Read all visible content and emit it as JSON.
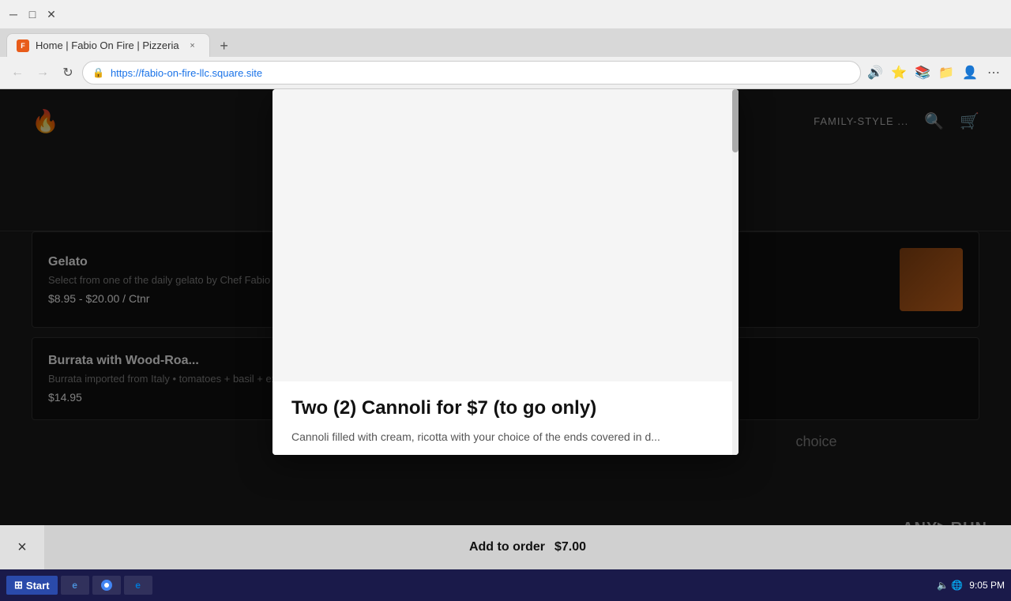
{
  "browser": {
    "title": "Home | Fabio On Fire | Pizzeria",
    "url": "https://fabio-on-fire-llc.square.site",
    "favicon_label": "F",
    "new_tab_label": "+",
    "back_btn": "←",
    "forward_btn": "→",
    "refresh_btn": "↻",
    "tab_close": "×"
  },
  "site": {
    "logo": "🔥",
    "nav_items": [
      "FAMILY-STYLE ...",
      "🔍",
      "🛒"
    ]
  },
  "menu_items": [
    {
      "name": "Gelato",
      "description": "Select from one of the daily gelato by Chef Fabio",
      "price": "$8.95 - $20.00 / Ctnr",
      "has_image": true
    },
    {
      "name": "Burrata with Wood-Roa...",
      "description": "Burrata imported from Italy • tomatoes + basil + extra-vir...",
      "price": "$14.95",
      "has_image": false
    }
  ],
  "modal": {
    "title": "Two (2) Cannoli for $7 (to go only)",
    "price": "$7.00",
    "description": "Cannoli filled with cream, ricotta with your choice of the ends covered in d...",
    "add_btn_label": "Add to order",
    "add_btn_price": "$7.00",
    "close_btn_label": "×"
  },
  "choice_text": "choice",
  "taskbar": {
    "start_label": "Start",
    "items": [
      {
        "label": "IE",
        "icon": "e"
      },
      {
        "label": "Chrome",
        "icon": "●"
      },
      {
        "label": "Edge",
        "icon": "e"
      }
    ],
    "time": "9:05 PM",
    "date": ""
  },
  "watermark": {
    "text": "ANY▶RUN"
  }
}
